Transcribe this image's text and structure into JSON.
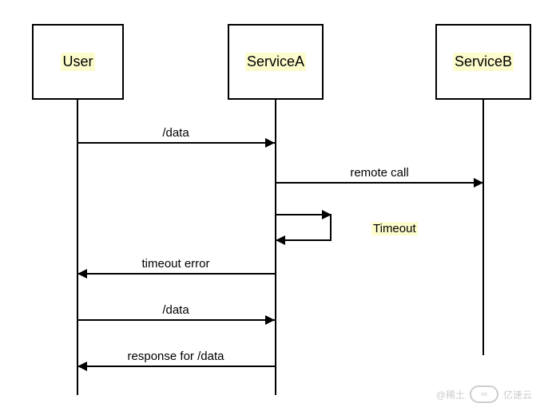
{
  "participants": {
    "user": "User",
    "serviceA": "ServiceA",
    "serviceB": "ServiceB"
  },
  "messages": {
    "data1": "/data",
    "remote_call": "remote call",
    "timeout": "Timeout",
    "timeout_error": "timeout error",
    "data2": "/data",
    "response": "response for /data"
  },
  "watermark": {
    "left": "@稀土",
    "brand": "亿速云"
  },
  "sequence": [
    {
      "from": "User",
      "to": "ServiceA",
      "label": "/data",
      "direction": "right"
    },
    {
      "from": "ServiceA",
      "to": "ServiceB",
      "label": "remote call",
      "direction": "right"
    },
    {
      "from": "ServiceA",
      "to": "ServiceA",
      "label": "Timeout",
      "type": "self"
    },
    {
      "from": "ServiceA",
      "to": "User",
      "label": "timeout error",
      "direction": "left"
    },
    {
      "from": "User",
      "to": "ServiceA",
      "label": "/data",
      "direction": "right"
    },
    {
      "from": "ServiceA",
      "to": "User",
      "label": "response for /data",
      "direction": "left"
    }
  ]
}
